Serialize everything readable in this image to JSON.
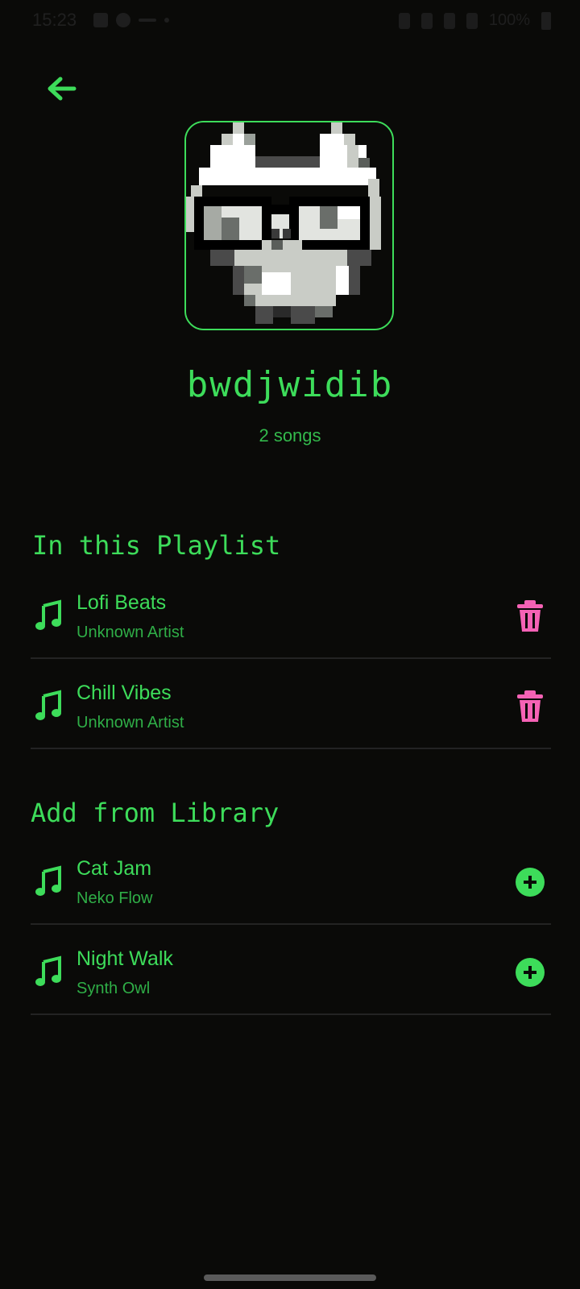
{
  "status_bar": {
    "time": "15:23",
    "battery": "100%"
  },
  "icons": {
    "back": "arrow-left-icon",
    "note": "music-note-icon",
    "remove": "trash-icon",
    "add": "plus-circle-icon"
  },
  "colors": {
    "accent": "#3ddc5a",
    "delete": "#f562b5",
    "background": "#0a0a08"
  },
  "playlist": {
    "name": "bwdjwidib",
    "count_text": "2 songs"
  },
  "sections": {
    "in_playlist": "In this Playlist",
    "add_from_library": "Add from Library"
  },
  "in_playlist_songs": [
    {
      "title": "Lofi Beats",
      "artist": "Unknown Artist"
    },
    {
      "title": "Chill Vibes",
      "artist": "Unknown Artist"
    }
  ],
  "library_songs": [
    {
      "title": "Cat Jam",
      "artist": "Neko Flow"
    },
    {
      "title": "Night Walk",
      "artist": "Synth Owl"
    }
  ]
}
